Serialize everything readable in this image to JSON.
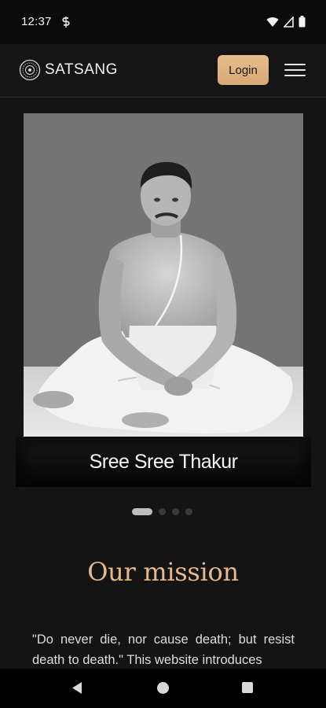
{
  "status_bar": {
    "time": "12:37",
    "icons": [
      "app-s-icon",
      "wifi-icon",
      "signal-icon",
      "battery-icon"
    ]
  },
  "header": {
    "brand": "SATSANG",
    "login_label": "Login",
    "accent_color": "#e0b384"
  },
  "carousel": {
    "caption": "Sree Sree Thakur",
    "slide_count": 4,
    "active_index": 0
  },
  "mission": {
    "title": "Our mission",
    "text": "\"Do never die, nor cause death; but resist death to death.\" This website introduces"
  },
  "nav_bar": {
    "icons": [
      "back-icon",
      "home-icon",
      "recents-icon"
    ]
  }
}
